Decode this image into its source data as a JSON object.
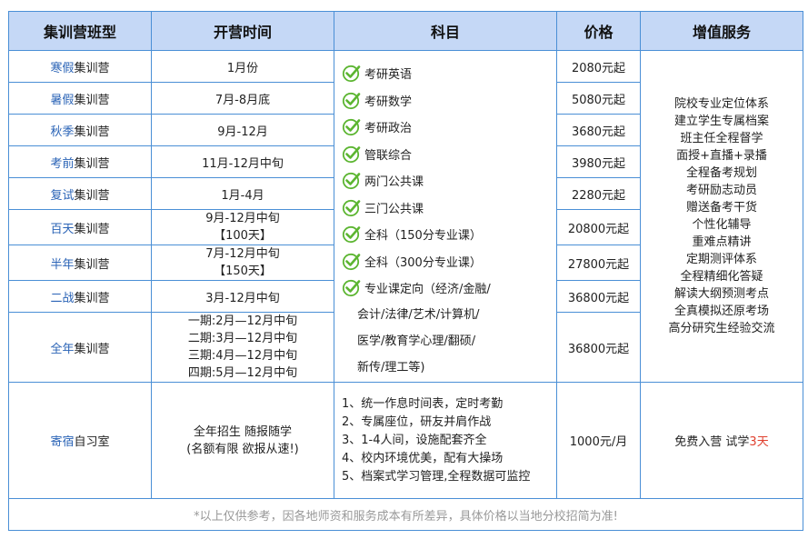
{
  "headers": [
    "集训营班型",
    "开营时间",
    "科目",
    "价格",
    "增值服务"
  ],
  "camps": [
    {
      "name_prefix": "寒假",
      "name_suffix": "集训营",
      "time": [
        "1月份"
      ],
      "price": "2080元起"
    },
    {
      "name_prefix": "暑假",
      "name_suffix": "集训营",
      "time": [
        "7月-8月底"
      ],
      "price": "5080元起"
    },
    {
      "name_prefix": "秋季",
      "name_suffix": "集训营",
      "time": [
        "9月-12月"
      ],
      "price": "3680元起"
    },
    {
      "name_prefix": "考前",
      "name_suffix": "集训营",
      "time": [
        "11月-12月中旬"
      ],
      "price": "3980元起"
    },
    {
      "name_prefix": "复试",
      "name_suffix": "集训营",
      "time": [
        "1月-4月"
      ],
      "price": "2280元起"
    },
    {
      "name_prefix": "百天",
      "name_suffix": "集训营",
      "time": [
        "9月-12月中旬",
        "【100天】"
      ],
      "price": "20800元起"
    },
    {
      "name_prefix": "半年",
      "name_suffix": "集训营",
      "time": [
        "7月-12月中旬",
        "【150天】"
      ],
      "price": "27800元起"
    },
    {
      "name_prefix": "二战",
      "name_suffix": "集训营",
      "time": [
        "3月-12月中旬"
      ],
      "price": "36800元起"
    },
    {
      "name_prefix": "全年",
      "name_suffix": "集训营",
      "time": [
        "一期:2月—12月中旬",
        "二期:3月—12月中旬",
        "三期:4月—12月中旬",
        "四期:5月—12月中旬"
      ],
      "price": "36800元起"
    }
  ],
  "subjects": [
    "考研英语",
    "考研数学",
    "考研政治",
    "管联综合",
    "两门公共课",
    "三门公共课",
    "全科（150分专业课）",
    "全科（300分专业课）",
    "专业课定向（经济/金融/"
  ],
  "subjects_extra": [
    "会计/法律/艺术/计算机/",
    "医学/教育学心理/翻硕/",
    "新传/理工等)"
  ],
  "services": [
    "院校专业定位体系",
    "建立学生专属档案",
    "班主任全程督学",
    "面授+直播+录播",
    "全程备考规划",
    "考研励志动员",
    "赠送备考干货",
    "个性化辅导",
    "重难点精讲",
    "定期测评体系",
    "全程精细化答疑",
    "解读大纲预测考点",
    "全真模拟还原考场",
    "高分研究生经验交流"
  ],
  "dorm": {
    "name_prefix": "寄宿",
    "name_suffix": "自习室",
    "time": [
      "全年招生 随报随学",
      "(名额有限 欲报从速!)"
    ],
    "features": [
      "1、统一作息时间表，定时考勤",
      "2、专属座位，研友并肩作战",
      "3、1-4人间，设施配套齐全",
      "4、校内环境优美，配有大操场",
      "5、档案式学习管理,全程数据可监控"
    ],
    "price": "1000元/月",
    "service_prefix": "免费入营 试学",
    "service_highlight": "3天"
  },
  "note": "*以上仅供参考，因各地师资和服务成本有所差异，具体价格以当地分校招简为准!",
  "colors": {
    "border": "#4a8fd6",
    "header_bg": "#c5d8f6",
    "accent_blue": "#2a63b6",
    "price_red": "#e0402f",
    "check_green": "#5cb531"
  },
  "icons": {
    "check": "check-circle-icon"
  }
}
